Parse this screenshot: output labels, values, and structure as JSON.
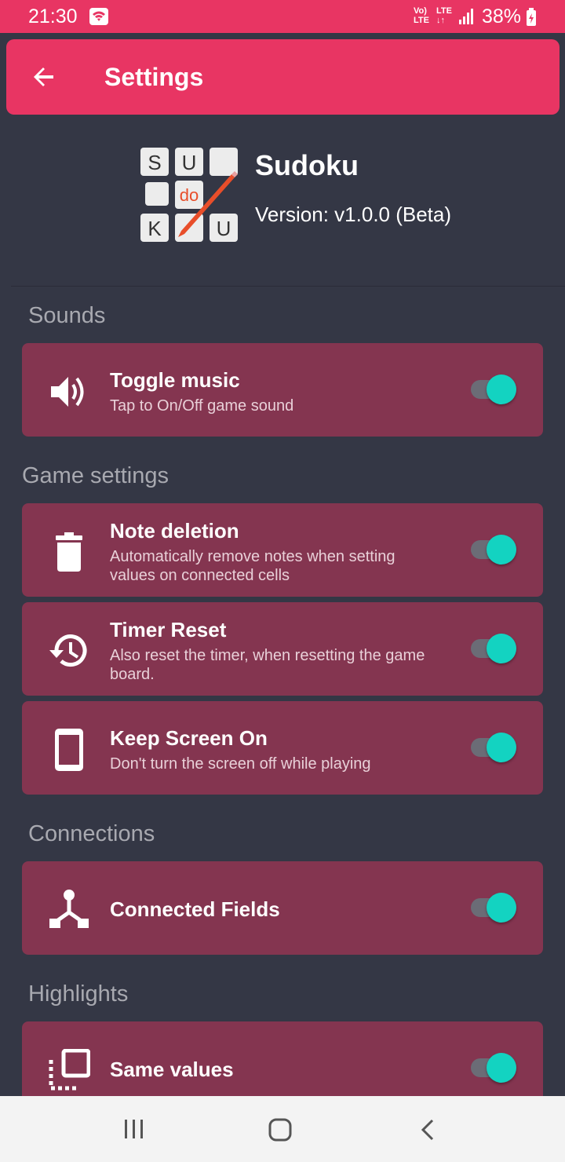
{
  "status_bar": {
    "time": "21:30",
    "net_top": "Vo)",
    "net_bottom": "LTE",
    "lte_top": "LTE",
    "battery": "38%"
  },
  "app_bar": {
    "title": "Settings",
    "back_icon": "arrow-left-icon"
  },
  "app_info": {
    "name": "Sudoku",
    "version": "Version: v1.0.0 (Beta)",
    "logo_letters": [
      "S",
      "U",
      "do",
      "K",
      "U"
    ]
  },
  "sections": [
    {
      "title": "Sounds",
      "items": [
        {
          "icon": "volume-icon",
          "label": "Toggle music",
          "description": "Tap to On/Off game sound",
          "enabled": true
        }
      ]
    },
    {
      "title": "Game settings",
      "items": [
        {
          "icon": "trash-icon",
          "label": "Note deletion",
          "description": "Automatically remove notes when setting values on connected cells",
          "enabled": true
        },
        {
          "icon": "history-icon",
          "label": "Timer Reset",
          "description": "Also reset the timer, when resetting the game board.",
          "enabled": true
        },
        {
          "icon": "phone-icon",
          "label": "Keep Screen On",
          "description": "Don't turn the screen off while playing",
          "enabled": true
        }
      ]
    },
    {
      "title": "Connections",
      "items": [
        {
          "icon": "connection-icon",
          "label": "Connected Fields",
          "description": "",
          "enabled": true
        }
      ]
    },
    {
      "title": "Highlights",
      "items": [
        {
          "icon": "select-icon",
          "label": "Same values",
          "description": "",
          "enabled": true
        }
      ]
    }
  ],
  "nav_bar": {
    "icons": [
      "recents-icon",
      "home-icon",
      "back-icon"
    ]
  },
  "colors": {
    "accent": "#e83563",
    "background": "#343745",
    "card": "#843550",
    "toggle_on": "#13d3c1"
  }
}
